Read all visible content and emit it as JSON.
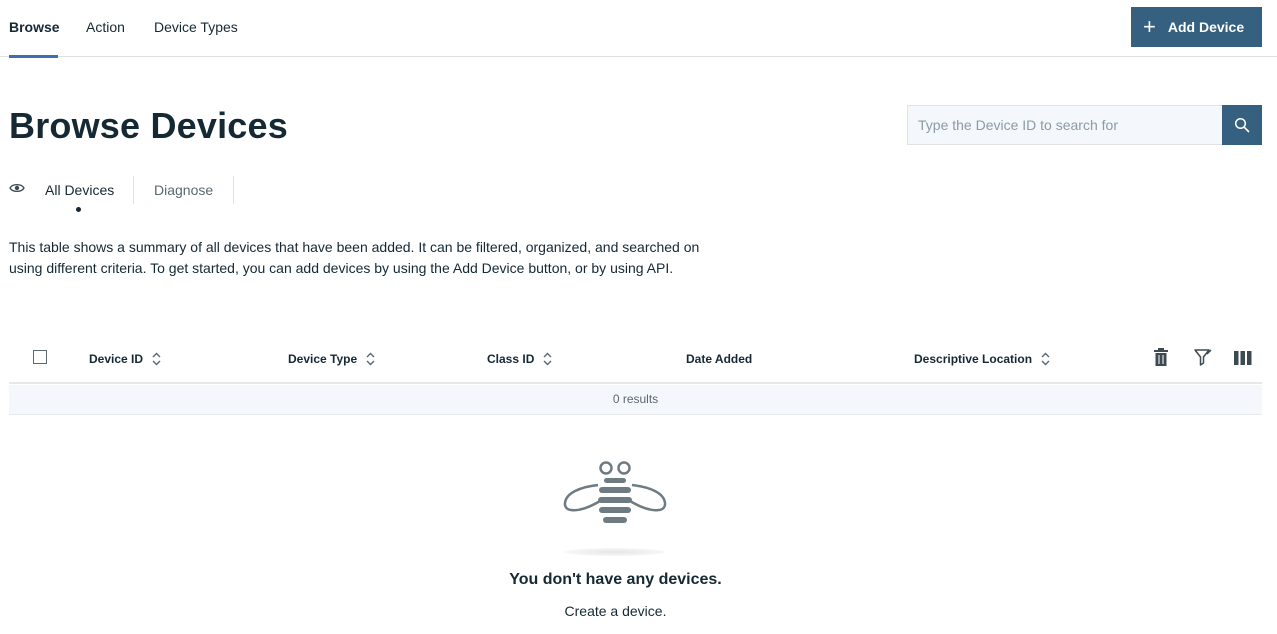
{
  "nav": {
    "tabs": [
      {
        "label": "Browse"
      },
      {
        "label": "Action"
      },
      {
        "label": "Device Types"
      }
    ],
    "add_device_label": "Add Device"
  },
  "page": {
    "title": "Browse Devices",
    "search_placeholder": "Type the Device ID to search for"
  },
  "view_tabs": [
    {
      "label": "All Devices",
      "selected": true
    },
    {
      "label": "Diagnose",
      "selected": false
    }
  ],
  "description": "This table shows a summary of all devices that have been added. It can be filtered, organized, and searched on using different criteria. To get started, you can add devices by using the Add Device button, or by using API.",
  "table": {
    "columns": [
      {
        "label": "Device ID",
        "sortable": true
      },
      {
        "label": "Device Type",
        "sortable": true
      },
      {
        "label": "Class ID",
        "sortable": true
      },
      {
        "label": "Date Added",
        "sortable": false
      },
      {
        "label": "Descriptive Location",
        "sortable": true
      }
    ],
    "results_text": "0 results",
    "toolbar_icons": [
      "trash-icon",
      "filter-icon",
      "columns-icon"
    ]
  },
  "empty_state": {
    "title": "You don't have any devices.",
    "subtitle": "Create a device."
  },
  "colors": {
    "primary": "#35607f",
    "accent": "#3d70b2",
    "text": "#152935"
  }
}
